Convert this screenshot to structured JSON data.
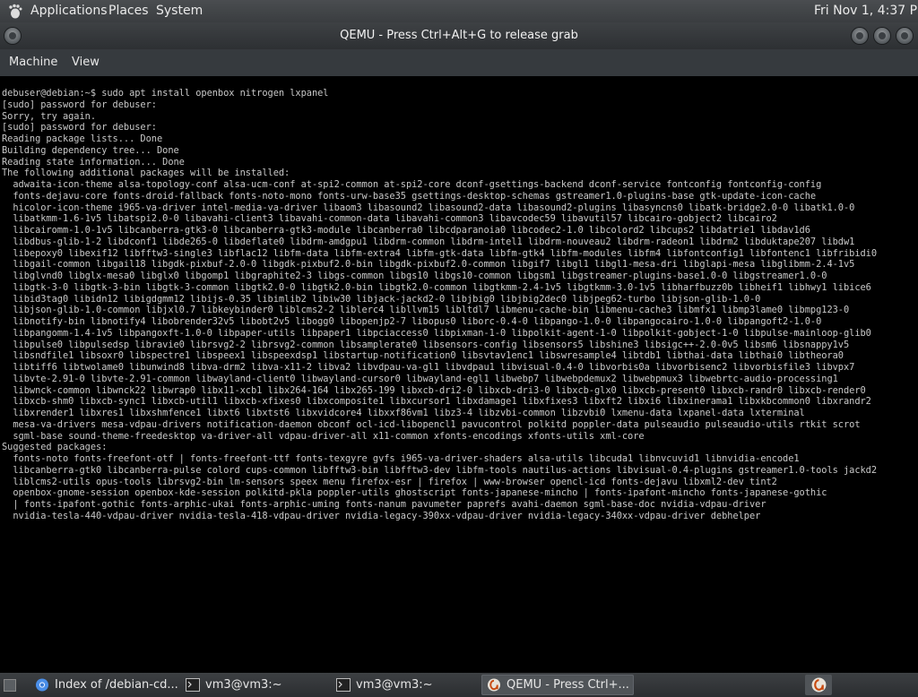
{
  "top_panel": {
    "menus": [
      "Applications",
      "Places",
      "System"
    ],
    "clock": "Fri Nov 1,  4:37 PM",
    "icons": [
      "gnome-foot-icon"
    ]
  },
  "window": {
    "title": "QEMU - Press Ctrl+Alt+G to release grab",
    "menubar": [
      "Machine",
      "View"
    ]
  },
  "terminal": {
    "lines": [
      "debuser@debian:~$ sudo apt install openbox nitrogen lxpanel",
      "[sudo] password for debuser:",
      "Sorry, try again.",
      "[sudo] password for debuser:",
      "Reading package lists... Done",
      "Building dependency tree... Done",
      "Reading state information... Done",
      "The following additional packages will be installed:",
      "  adwaita-icon-theme alsa-topology-conf alsa-ucm-conf at-spi2-common at-spi2-core dconf-gsettings-backend dconf-service fontconfig fontconfig-config",
      "  fonts-dejavu-core fonts-droid-fallback fonts-noto-mono fonts-urw-base35 gsettings-desktop-schemas gstreamer1.0-plugins-base gtk-update-icon-cache",
      "  hicolor-icon-theme i965-va-driver intel-media-va-driver libaom3 libasound2 libasound2-data libasound2-plugins libasyncns0 libatk-bridge2.0-0 libatk1.0-0",
      "  libatkmm-1.6-1v5 libatspi2.0-0 libavahi-client3 libavahi-common-data libavahi-common3 libavcodec59 libavutil57 libcairo-gobject2 libcairo2",
      "  libcairomm-1.0-1v5 libcanberra-gtk3-0 libcanberra-gtk3-module libcanberra0 libcdparanoia0 libcodec2-1.0 libcolord2 libcups2 libdatrie1 libdav1d6",
      "  libdbus-glib-1-2 libdconf1 libde265-0 libdeflate0 libdrm-amdgpu1 libdrm-common libdrm-intel1 libdrm-nouveau2 libdrm-radeon1 libdrm2 libduktape207 libdw1",
      "  libepoxy0 libexif12 libfftw3-single3 libflac12 libfm-data libfm-extra4 libfm-gtk-data libfm-gtk4 libfm-modules libfm4 libfontconfig1 libfontenc1 libfribidi0",
      "  libgail-common libgail18 libgdk-pixbuf-2.0-0 libgdk-pixbuf2.0-bin libgdk-pixbuf2.0-common libgif7 libgl1 libgl1-mesa-dri libglapi-mesa libglibmm-2.4-1v5",
      "  libglvnd0 libglx-mesa0 libglx0 libgomp1 libgraphite2-3 libgs-common libgs10 libgs10-common libgsm1 libgstreamer-plugins-base1.0-0 libgstreamer1.0-0",
      "  libgtk-3-0 libgtk-3-bin libgtk-3-common libgtk2.0-0 libgtk2.0-bin libgtk2.0-common libgtkmm-2.4-1v5 libgtkmm-3.0-1v5 libharfbuzz0b libheif1 libhwy1 libice6",
      "  libid3tag0 libidn12 libigdgmm12 libijs-0.35 libimlib2 libiw30 libjack-jackd2-0 libjbig0 libjbig2dec0 libjpeg62-turbo libjson-glib-1.0-0",
      "  libjson-glib-1.0-common libjxl0.7 libkeybinder0 liblcms2-2 liblerc4 libllvm15 libltdl7 libmenu-cache-bin libmenu-cache3 libmfx1 libmp3lame0 libmpg123-0",
      "  libnotify-bin libnotify4 libobrender32v5 libobt2v5 libogg0 libopenjp2-7 libopus0 liborc-0.4-0 libpango-1.0-0 libpangocairo-1.0-0 libpangoft2-1.0-0",
      "  libpangomm-1.4-1v5 libpangoxft-1.0-0 libpaper-utils libpaper1 libpciaccess0 libpixman-1-0 libpolkit-agent-1-0 libpolkit-gobject-1-0 libpulse-mainloop-glib0",
      "  libpulse0 libpulsedsp libravie0 librsvg2-2 librsvg2-common libsamplerate0 libsensors-config libsensors5 libshine3 libsigc++-2.0-0v5 libsm6 libsnappy1v5",
      "  libsndfile1 libsoxr0 libspectre1 libspeex1 libspeexdsp1 libstartup-notification0 libsvtav1enc1 libswresample4 libtdb1 libthai-data libthai0 libtheora0",
      "  libtiff6 libtwolame0 libunwind8 libva-drm2 libva-x11-2 libva2 libvdpau-va-gl1 libvdpau1 libvisual-0.4-0 libvorbis0a libvorbisenc2 libvorbisfile3 libvpx7",
      "  libvte-2.91-0 libvte-2.91-common libwayland-client0 libwayland-cursor0 libwayland-egl1 libwebp7 libwebpdemux2 libwebpmux3 libwebrtc-audio-processing1",
      "  libwnck-common libwnck22 libwrap0 libx11-xcb1 libx264-164 libx265-199 libxcb-dri2-0 libxcb-dri3-0 libxcb-glx0 libxcb-present0 libxcb-randr0 libxcb-render0",
      "  libxcb-shm0 libxcb-sync1 libxcb-util1 libxcb-xfixes0 libxcomposite1 libxcursor1 libxdamage1 libxfixes3 libxft2 libxi6 libxinerama1 libxkbcommon0 libxrandr2",
      "  libxrender1 libxres1 libxshmfence1 libxt6 libxtst6 libxvidcore4 libxxf86vm1 libz3-4 libzvbi-common libzvbi0 lxmenu-data lxpanel-data lxterminal",
      "  mesa-va-drivers mesa-vdpau-drivers notification-daemon obconf ocl-icd-libopencl1 pavucontrol polkitd poppler-data pulseaudio pulseaudio-utils rtkit scrot",
      "  sgml-base sound-theme-freedesktop va-driver-all vdpau-driver-all x11-common xfonts-encodings xfonts-utils xml-core",
      "Suggested packages:",
      "  fonts-noto fonts-freefont-otf | fonts-freefont-ttf fonts-texgyre gvfs i965-va-driver-shaders alsa-utils libcuda1 libnvcuvid1 libnvidia-encode1",
      "  libcanberra-gtk0 libcanberra-pulse colord cups-common libfftw3-bin libfftw3-dev libfm-tools nautilus-actions libvisual-0.4-plugins gstreamer1.0-tools jackd2",
      "  liblcms2-utils opus-tools librsvg2-bin lm-sensors speex menu firefox-esr | firefox | www-browser opencl-icd fonts-dejavu libxml2-dev tint2",
      "  openbox-gnome-session openbox-kde-session polkitd-pkla poppler-utils ghostscript fonts-japanese-mincho | fonts-ipafont-mincho fonts-japanese-gothic",
      "  | fonts-ipafont-gothic fonts-arphic-ukai fonts-arphic-uming fonts-nanum pavumeter paprefs avahi-daemon sgml-base-doc nvidia-vdpau-driver",
      "  nvidia-tesla-440-vdpau-driver nvidia-tesla-418-vdpau-driver nvidia-legacy-390xx-vdpau-driver nvidia-legacy-340xx-vdpau-driver debhelper"
    ]
  },
  "taskbar": {
    "tasks": [
      {
        "label": "Index of /debian-cd...",
        "icon": "chromium-icon",
        "active": false
      },
      {
        "label": "vm3@vm3:~",
        "icon": "terminal-icon",
        "active": false
      },
      {
        "label": "vm3@vm3:~",
        "icon": "terminal-icon",
        "active": false
      },
      {
        "label": "QEMU - Press Ctrl+...",
        "icon": "qemu-icon",
        "active": true
      }
    ]
  }
}
